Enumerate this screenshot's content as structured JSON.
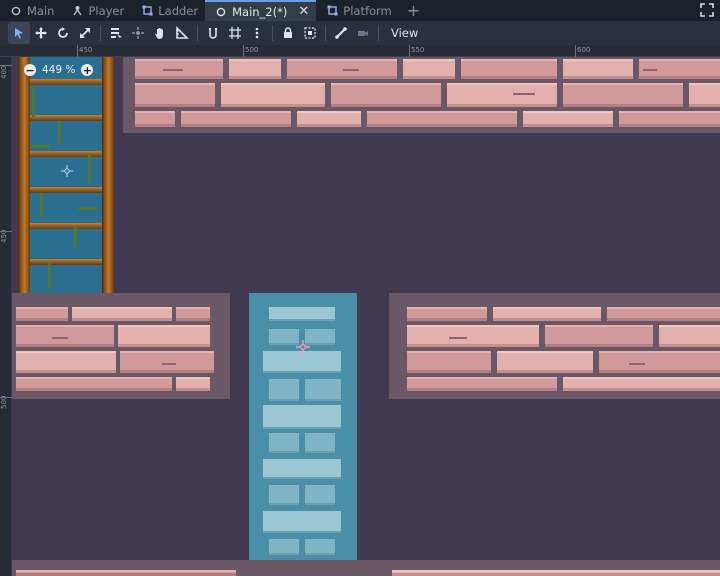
{
  "tabs": [
    {
      "label": "Main",
      "icon": "scene-circle-icon",
      "active": false
    },
    {
      "label": "Player",
      "icon": "player-icon",
      "active": false
    },
    {
      "label": "Ladder",
      "icon": "scene-frame-icon",
      "active": false
    },
    {
      "label": "Main_2(*)",
      "icon": "scene-circle-icon",
      "active": true,
      "closable": true
    },
    {
      "label": "Platform",
      "icon": "scene-frame-icon",
      "active": false
    }
  ],
  "toolbar": {
    "tools": [
      "select-icon",
      "move-icon",
      "rotate-icon",
      "scale-icon",
      "list-select-icon",
      "pivot-icon",
      "pan-icon",
      "ruler-icon",
      "smart-snap-icon",
      "grid-snap-icon",
      "more-icon",
      "lock-icon",
      "group-icon",
      "bone-icon",
      "camera-icon"
    ],
    "view_label": "View"
  },
  "ruler": {
    "top_labels": [
      "450",
      "500",
      "550",
      "600"
    ],
    "left_labels": [
      "400",
      "450",
      "500"
    ]
  },
  "zoom": {
    "value": "449 %",
    "minus": "−",
    "plus": "+"
  },
  "colors": {
    "accent": "#6aa0e8",
    "viewport_bg": "#41394f",
    "brick": "#d09a9a",
    "platform_selected": "#4a8fa8"
  }
}
